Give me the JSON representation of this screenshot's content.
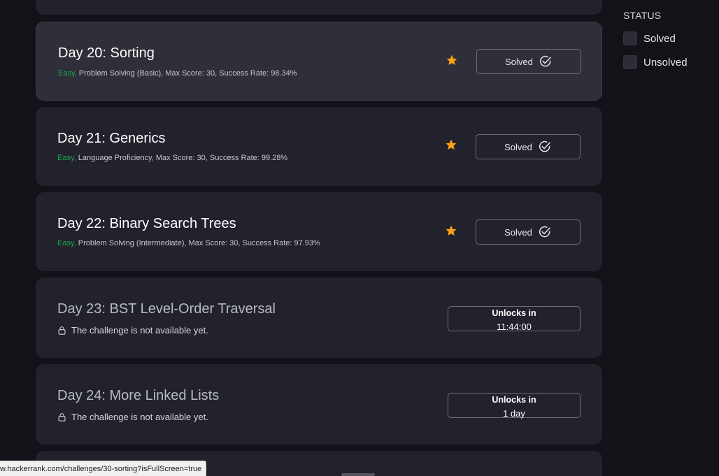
{
  "challenges": [
    {
      "title": "Day 20: Sorting",
      "difficulty": "Easy,",
      "details": " Problem Solving (Basic), Max Score: 30, Success Rate: 98.34%",
      "status_label": "Solved",
      "star_icon": "star-icon",
      "check_icon": "check-circle-icon"
    },
    {
      "title": "Day 21: Generics",
      "difficulty": "Easy,",
      "details": " Language Proficiency, Max Score: 30, Success Rate: 99.28%",
      "status_label": "Solved",
      "star_icon": "star-icon",
      "check_icon": "check-circle-icon"
    },
    {
      "title": "Day 22: Binary Search Trees",
      "difficulty": "Easy,",
      "details": " Problem Solving (Intermediate), Max Score: 30, Success Rate: 97.93%",
      "status_label": "Solved",
      "star_icon": "star-icon",
      "check_icon": "check-circle-icon"
    },
    {
      "title": "Day 23: BST Level-Order Traversal",
      "lock_message": "The challenge is not available yet.",
      "unlock_label": "Unlocks in",
      "unlock_time": "11:44:00",
      "lock_icon": "lock-icon"
    },
    {
      "title": "Day 24: More Linked Lists",
      "lock_message": "The challenge is not available yet.",
      "unlock_label": "Unlocks in",
      "unlock_time": "1 day",
      "lock_icon": "lock-icon"
    }
  ],
  "filters": {
    "title": "STATUS",
    "options": [
      "Solved",
      "Unsolved"
    ]
  },
  "browser_status_url": "w.hackerrank.com/challenges/30-sorting?isFullScreen=true",
  "colors": {
    "background": "#121218",
    "card": "#22222c",
    "card_hover": "#2e2f38",
    "easy": "#1ba94c",
    "star": "#ffa116"
  }
}
